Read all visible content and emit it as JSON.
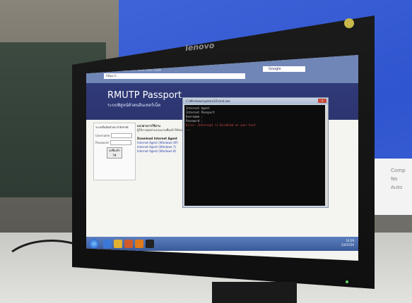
{
  "monitor": {
    "brand": "lenovo"
  },
  "projection": {
    "side_text": [
      "Comp",
      "No",
      "Auto"
    ]
  },
  "browser": {
    "tabs": [
      {
        "label": "RMUTP Passport",
        "active": true
      },
      {
        "label": "...",
        "active": false
      },
      {
        "label": "...",
        "active": false
      },
      {
        "label": "...",
        "active": false
      },
      {
        "label": "...",
        "active": false
      }
    ],
    "address": "https://...",
    "search_placeholder": "Google"
  },
  "portal": {
    "title": "RMUTP Passport",
    "subtitle": "ระบบพิสูจน์ตัวตนอินเทอร์เน็ต",
    "login": {
      "heading": "ระบบยืนยันตัวตน Internet",
      "username_label": "Username",
      "password_label": "Password",
      "button": "ลงชื่อเข้าใช้"
    },
    "content": {
      "heading1": "แนวทางการใช้งาน",
      "text1": "ผู้ใช้งานทุกท่านกรุณาลงชื่อเข้าใช้ก่อนใช้งาน Internet",
      "heading2": "Download Internet Agent",
      "link1": "Internet Agent (Windows XP)",
      "link2": "Internet Agent (Windows 7)",
      "link3": "Internet Agent (Windows 8)"
    }
  },
  "console": {
    "title": "C:\\Windows\\system32\\cmd.exe",
    "close": "x",
    "lines": [
      "Internet Agent",
      "",
      "Internet Passport",
      "Username :",
      "Password :",
      "Error: Intercept is Disabled on your host",
      "",
      "..."
    ]
  },
  "taskbar": {
    "clock_time": "14:29",
    "clock_date": "2/4/2556"
  }
}
